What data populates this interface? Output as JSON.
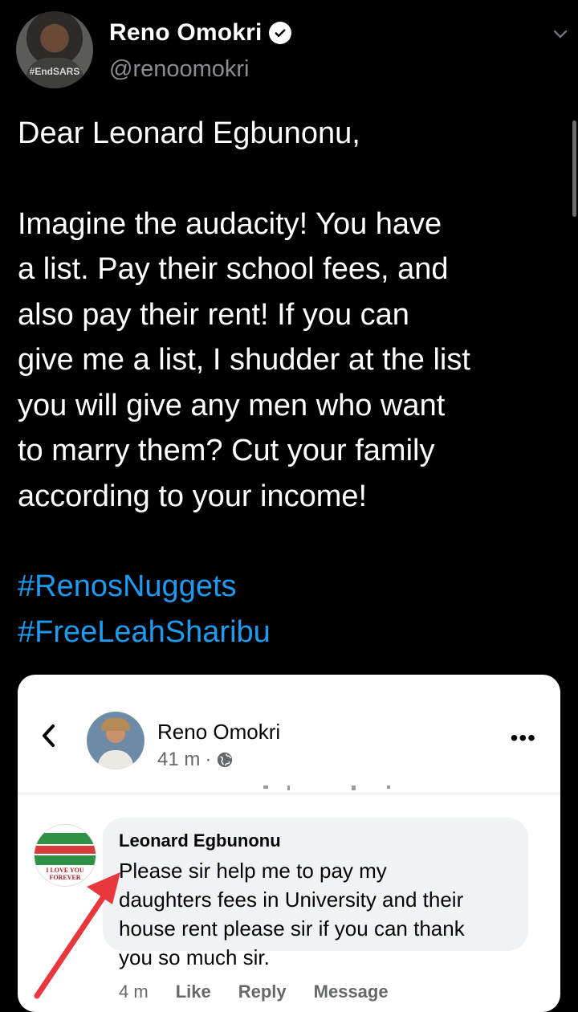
{
  "tweet": {
    "display_name": "Reno Omokri",
    "handle": "@renoomokri",
    "avatar_badge_text": "#EndSARS",
    "greeting": "Dear Leonard Egbunonu,",
    "body_lines": [
      "Imagine the audacity! You have",
      "a list. Pay their school fees, and",
      "also pay their rent! If you can",
      "give me a list, I shudder at the list",
      "you will give any men who want",
      "to marry them? Cut your family",
      "according to your income!"
    ],
    "hashtags": [
      "#RenosNuggets",
      "#FreeLeahSharibu"
    ],
    "colors": {
      "hashtag": "#1d9bf0",
      "handle": "#8a8d91"
    }
  },
  "embedded_post": {
    "author": "Reno Omokri",
    "time": "41 m",
    "separator": "·",
    "comment": {
      "author": "Leonard Egbunonu",
      "avatar_text": "I LOVE YOU FOREVER",
      "lines": [
        "Please sir help me to pay my",
        "daughters fees in University and their",
        "house rent please sir if you can thank",
        "you so much sir."
      ],
      "time": "4 m",
      "actions": [
        "Like",
        "Reply",
        "Message"
      ]
    },
    "arrow_color": "#e8383d"
  }
}
